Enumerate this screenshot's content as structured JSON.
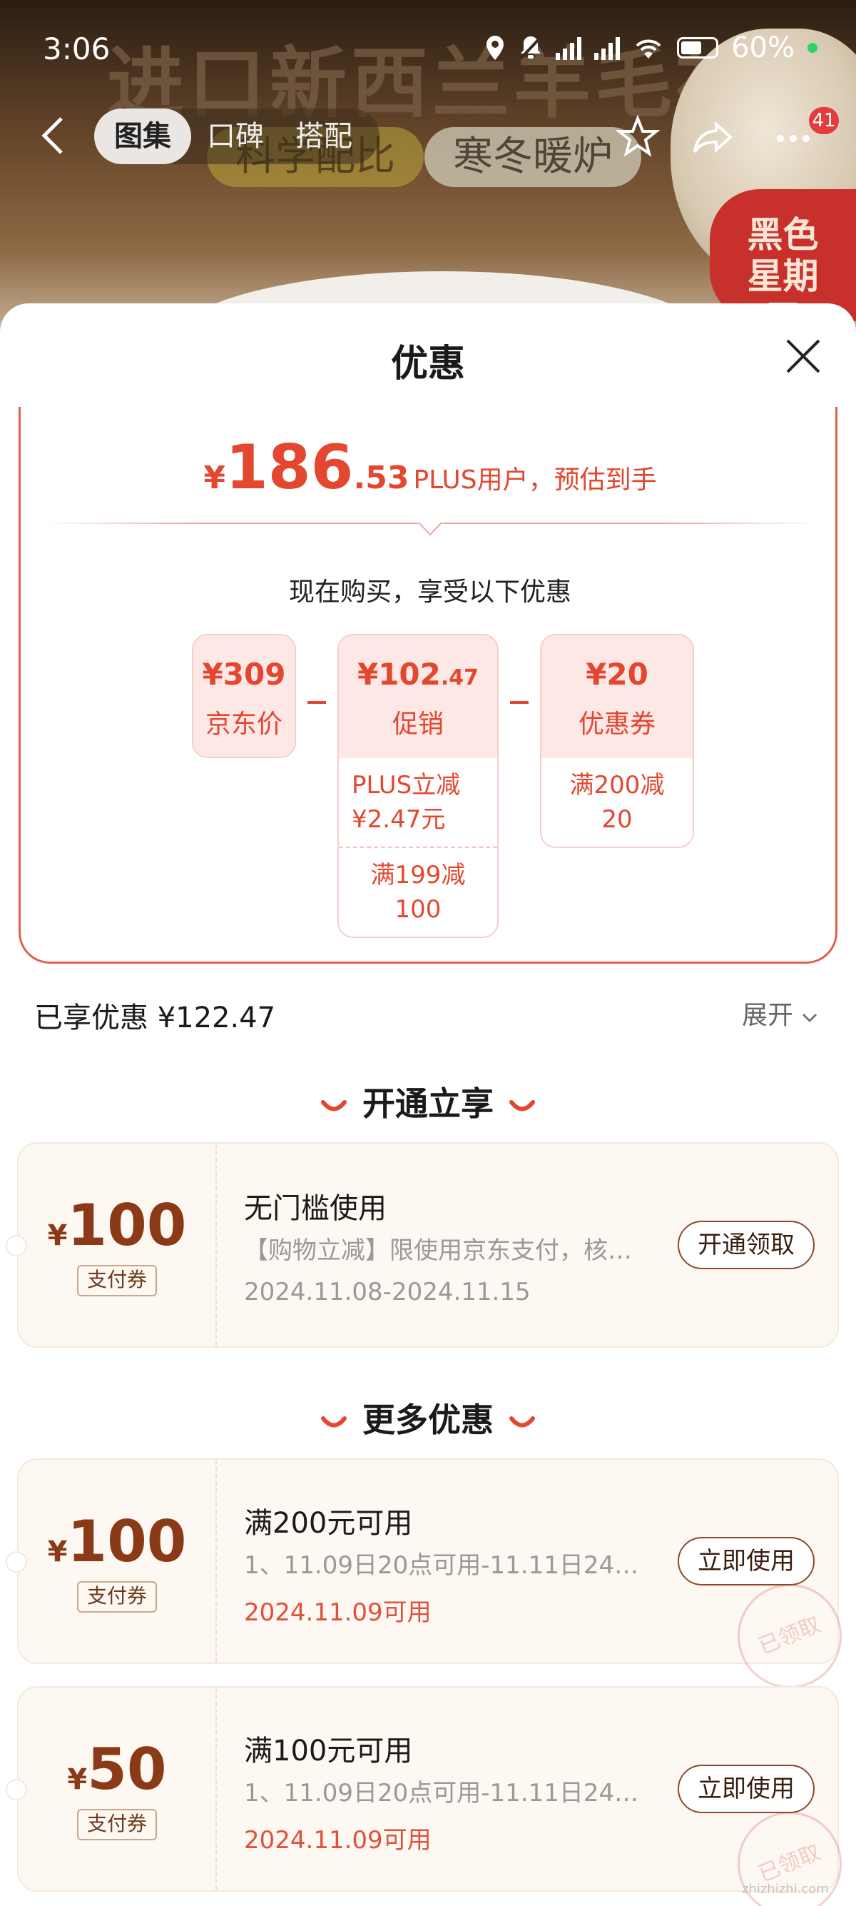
{
  "status_bar": {
    "time": "3:06",
    "battery": "60%"
  },
  "banner": {
    "title": "进口新西兰羊毛被",
    "pill_a": "科学配比",
    "pill_b": "寒冬暖炉",
    "promo_badge": "黑色星期五"
  },
  "nav": {
    "tabs": [
      {
        "label": "图集"
      },
      {
        "label": "口碑"
      },
      {
        "label": "搭配"
      }
    ],
    "badge_count": "41"
  },
  "sheet": {
    "title": "优惠",
    "price": {
      "symbol": "¥",
      "integer": "186",
      "decimal": ".53",
      "suffix": "PLUS用户，预估到手"
    },
    "buy_label": "现在购买，享受以下优惠",
    "breakdown": [
      {
        "value": "¥309",
        "label": "京东价"
      },
      {
        "value_main": "¥102",
        "value_small": ".47",
        "label": "促销",
        "subs": [
          "PLUS立减 ¥2.47元",
          "满199减100"
        ]
      },
      {
        "value": "¥20",
        "label": "优惠券",
        "subs": [
          "满200减20"
        ]
      }
    ],
    "enjoyed": "已享优惠 ¥122.47",
    "expand": "展开"
  },
  "sections": {
    "open_now": "开通立享",
    "more": "更多优惠"
  },
  "coupons": [
    {
      "symbol": "¥",
      "amount": "100",
      "tag": "支付券",
      "title": "无门槛使用",
      "desc": "【购物立减】限使用京东支付，核…",
      "date": "2024.11.08-2024.11.15",
      "button": "开通领取"
    },
    {
      "symbol": "¥",
      "amount": "100",
      "tag": "支付券",
      "title": "满200元可用",
      "desc": "1、11.09日20点可用-11.11日24点…",
      "date": "2024.11.09可用",
      "button": "立即使用",
      "stamp": "已领取"
    },
    {
      "symbol": "¥",
      "amount": "50",
      "tag": "支付券",
      "title": "满100元可用",
      "desc": "1、11.09日20点可用-11.11日24点…",
      "date": "2024.11.09可用",
      "button": "立即使用",
      "stamp": "已领取"
    }
  ],
  "colors": {
    "accent_red": "#e4472f",
    "coupon_brown": "#8a3a17"
  },
  "watermark": "zhizhizhi.com"
}
